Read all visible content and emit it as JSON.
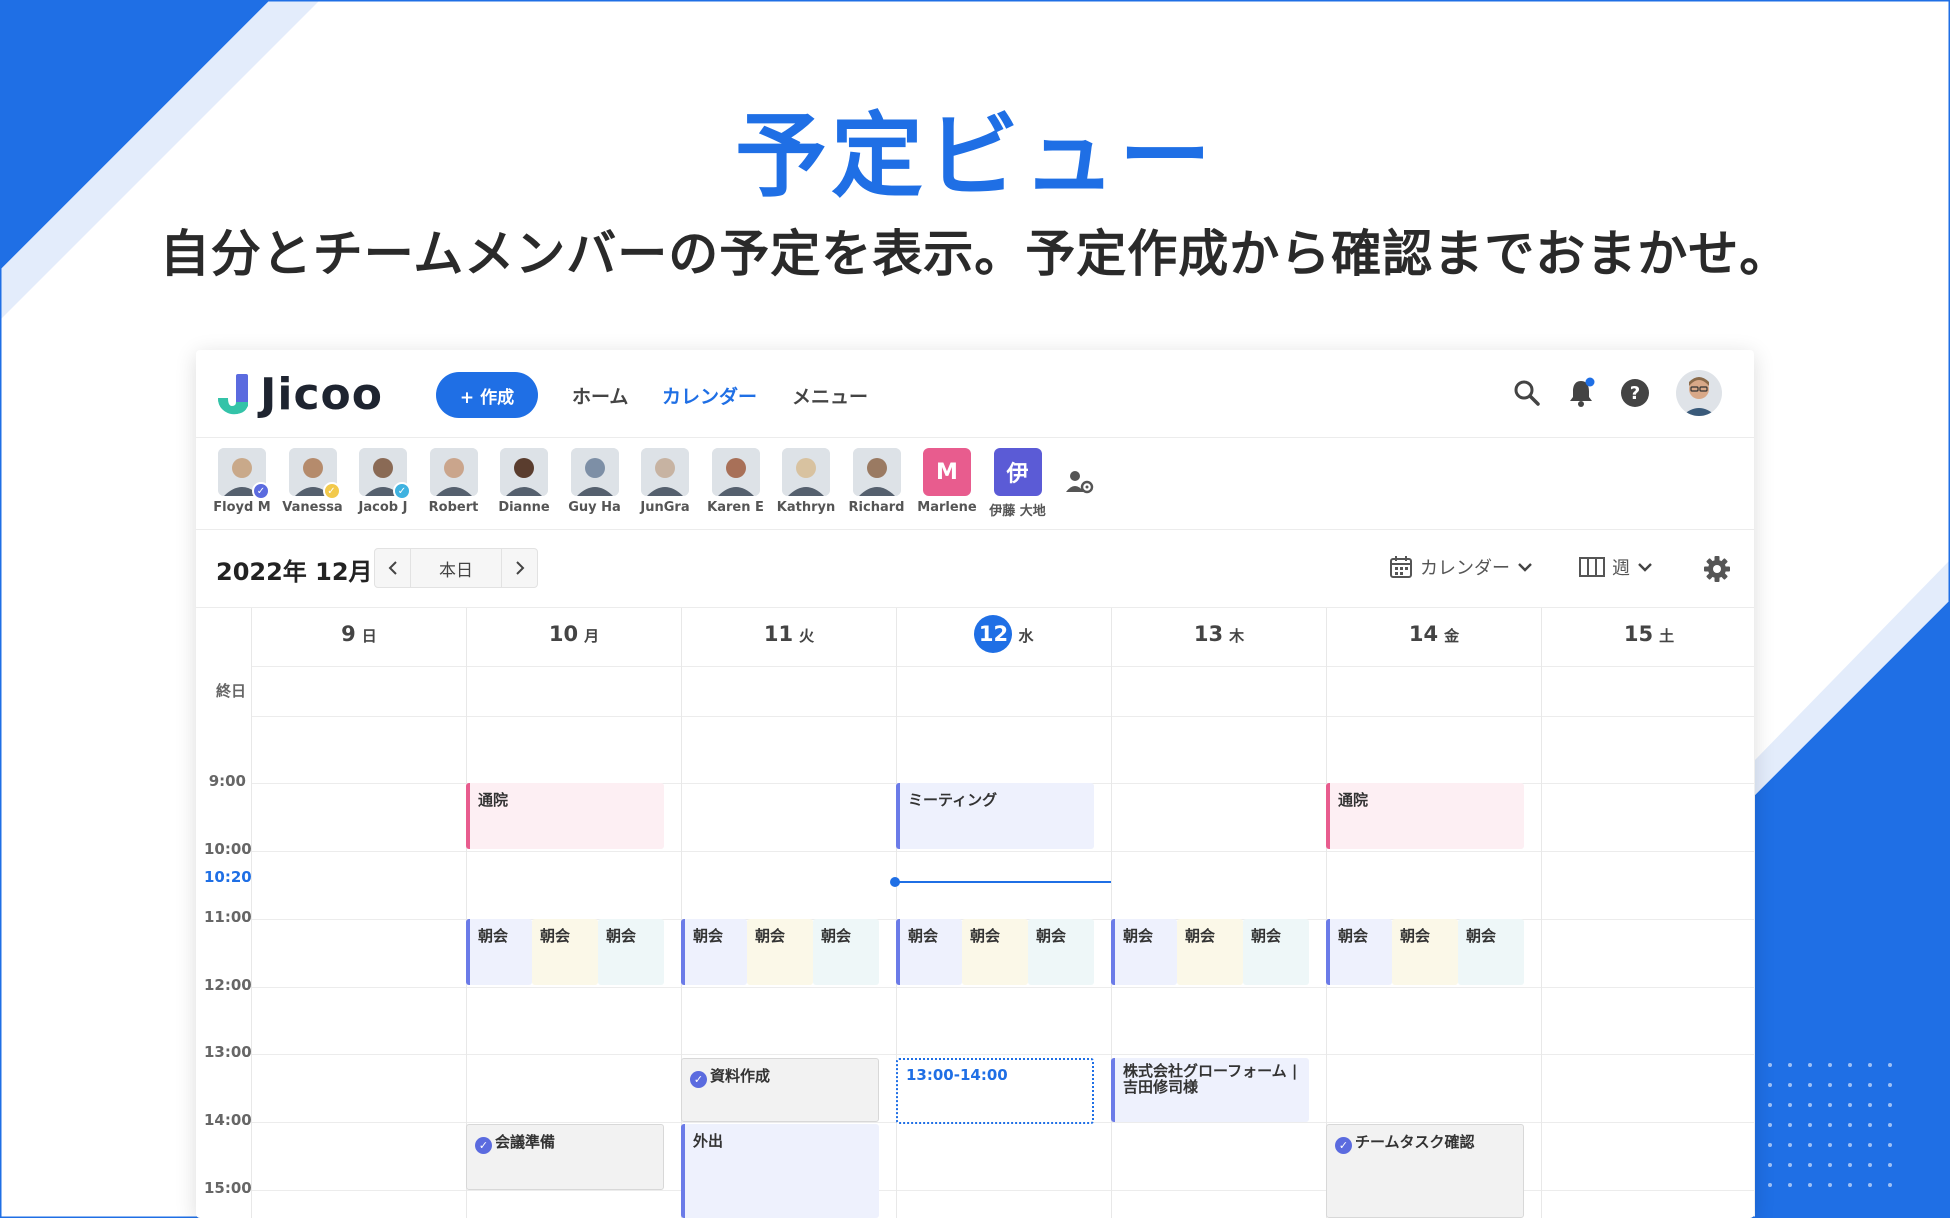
{
  "hero": {
    "title": "予定ビュー",
    "subtitle": "自分とチームメンバーの予定を表示。予定作成から確認までおまかせ。"
  },
  "header": {
    "logo_text": "Jicoo",
    "create_label": "+ 作成",
    "nav": [
      "ホーム",
      "カレンダー",
      "メニュー"
    ],
    "active_nav": "カレンダー",
    "icons": [
      "search-icon",
      "bell-icon",
      "help-icon"
    ]
  },
  "members": [
    {
      "name": "Floyd M",
      "check": "#5b6bdf",
      "color": "#c9a98a"
    },
    {
      "name": "Vanessa",
      "check": "#f2c94c",
      "color": "#b58b6c"
    },
    {
      "name": "Jacob J",
      "check": "#3fb2e0",
      "color": "#8a6a55"
    },
    {
      "name": "Robert",
      "check": "",
      "color": "#caa58c"
    },
    {
      "name": "Dianne",
      "check": "",
      "color": "#5a3d2e"
    },
    {
      "name": "Guy Ha",
      "check": "",
      "color": "#7d8fa6"
    },
    {
      "name": "JunGra",
      "check": "",
      "color": "#c7b3a2"
    },
    {
      "name": "Karen E",
      "check": "",
      "color": "#a87058"
    },
    {
      "name": "Kathryn",
      "check": "",
      "color": "#d8c2a0"
    },
    {
      "name": "Richard",
      "check": "",
      "color": "#9a7a62"
    },
    {
      "name": "Marlene",
      "initial": "M",
      "color": "#e85c8e"
    },
    {
      "name": "伊藤 大地",
      "initial": "伊",
      "color": "#5b5bd6"
    }
  ],
  "toolbar": {
    "month": "2022年 12月",
    "today": "本日",
    "calendar_label": "カレンダー",
    "view_label": "週"
  },
  "days": [
    {
      "num": "9",
      "dow": "日"
    },
    {
      "num": "10",
      "dow": "月"
    },
    {
      "num": "11",
      "dow": "火"
    },
    {
      "num": "12",
      "dow": "水",
      "today": true
    },
    {
      "num": "13",
      "dow": "木"
    },
    {
      "num": "14",
      "dow": "金"
    },
    {
      "num": "15",
      "dow": "土"
    }
  ],
  "allday_label": "終日",
  "times": [
    "9:00",
    "10:00",
    "11:00",
    "12:00",
    "13:00",
    "14:00",
    "15:00"
  ],
  "current_time": "10:20",
  "events": {
    "tsuin": "通院",
    "meeting": "ミーティング",
    "chokai": "朝会",
    "shiryo": "資料作成",
    "slot": "13:00-14:00",
    "client": "株式会社グローフォーム | 吉田修司様",
    "kaigi": "会議準備",
    "gaishutsu": "外出",
    "team": "チームタスク確認"
  },
  "colors": {
    "accent": "#1f6fe5"
  }
}
